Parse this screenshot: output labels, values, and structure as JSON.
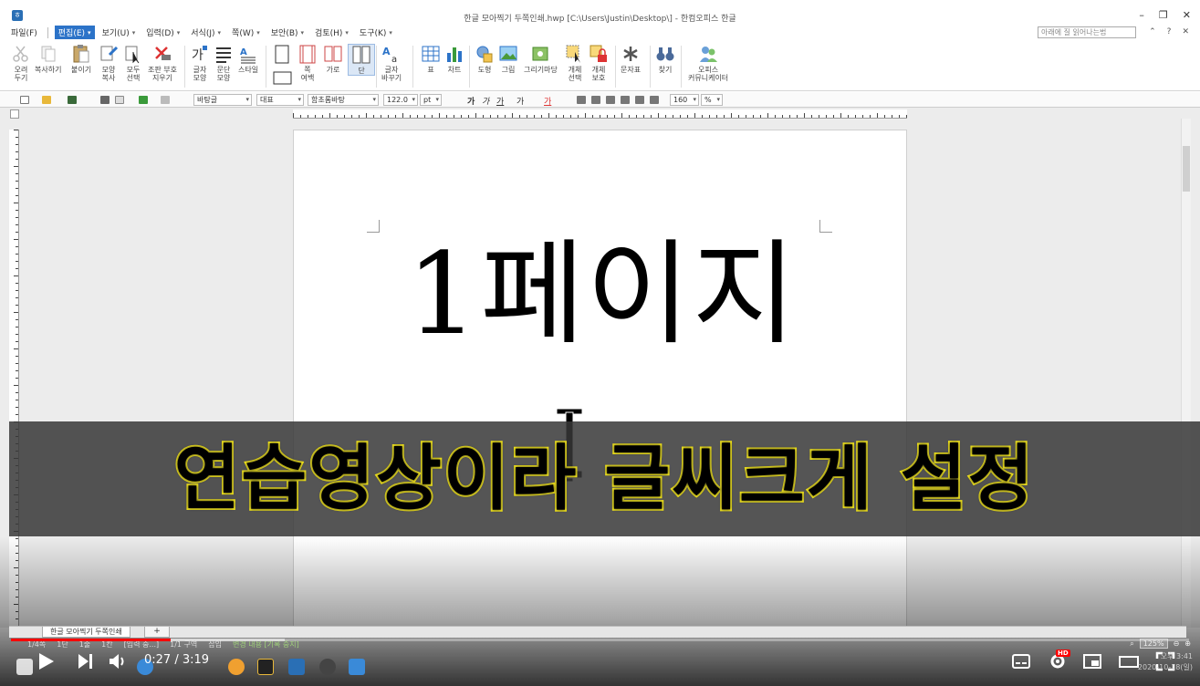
{
  "window": {
    "title": "한글 모아찍기 두쪽인쇄.hwp [C:\\Users\\Justin\\Desktop\\] - 한컴오피스 한글",
    "minimize": "–",
    "restore": "❐",
    "close": "✕"
  },
  "menu": {
    "items": [
      {
        "label": "파일(F)",
        "active": false
      },
      {
        "label": "편집(E)",
        "active": true
      },
      {
        "label": "보기(U)",
        "active": false
      },
      {
        "label": "입력(D)",
        "active": false
      },
      {
        "label": "서식(J)",
        "active": false
      },
      {
        "label": "쪽(W)",
        "active": false
      },
      {
        "label": "보안(B)",
        "active": false
      },
      {
        "label": "검토(H)",
        "active": false
      },
      {
        "label": "도구(K)",
        "active": false
      }
    ],
    "help_placeholder": "아래에 질 읽어나는법",
    "right": [
      "⌃",
      "?",
      "✕"
    ]
  },
  "ribbon": {
    "cut": "오려\n두기",
    "copy": "복사하기",
    "paste": "붙이기",
    "format_copy": "모양\n복사",
    "select_all": "모두\n선택",
    "clear_format": "조판 부호\n지우기",
    "char_shape": "글자\n모양",
    "para_shape": "문단\n모양",
    "style": "스타일",
    "page_margin": "쪽\n여백",
    "landscape": "가로",
    "column": "단",
    "char_change": "글자\n바꾸기",
    "table": "표",
    "chart": "차트",
    "shape": "도형",
    "picture": "그림",
    "draw_picture": "그리기마당",
    "object_select": "개체\n선택",
    "object_protect": "개체\n보호",
    "symbol": "문자표",
    "find": "찾기",
    "office_comm": "오피스\n커뮤니케이터"
  },
  "format_bar": {
    "style": "바탕글",
    "lang": "대표",
    "font": "함초롬바탕",
    "size": "122.0",
    "unit": "pt",
    "bold": "가",
    "italic": "가",
    "underline": "가",
    "strike": "가",
    "line_spacing": "160",
    "percent": "%"
  },
  "document": {
    "main_text": "1페이지"
  },
  "subtitle": {
    "text": "연습영상이라 글씨크게 설정"
  },
  "tabs": {
    "doc_tab": "한글 모아찍기 두쪽인쇄",
    "add": "+"
  },
  "status": {
    "page": "1/4쪽",
    "column": "1단",
    "line": "1줄",
    "col": "1칸",
    "mode": "[입력 중...]",
    "section": "1/1 구역",
    "insert": "삽입",
    "change": "변경 내용 [기록 중지]"
  },
  "zoom": {
    "value": "125%"
  },
  "video": {
    "current_time": "0:27",
    "separator": " / ",
    "duration": "3:19",
    "progress": 0.1357,
    "hd_badge": "HD"
  },
  "clock": {
    "time": "오후 3:41",
    "date": "2020-10-18(일)"
  },
  "colors": {
    "accent": "#2c73c8",
    "subtitle_stroke": "#f6e81a",
    "progress": "#ff0000"
  }
}
